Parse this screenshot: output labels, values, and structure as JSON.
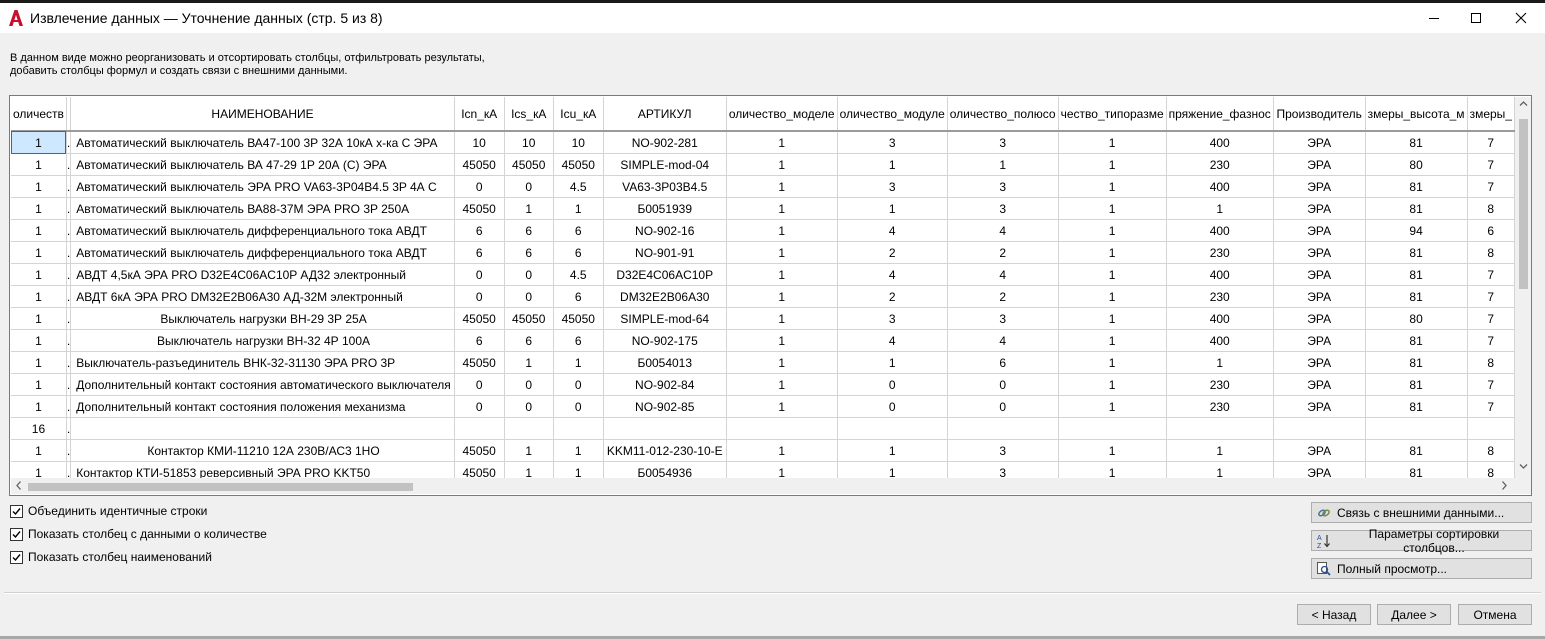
{
  "window": {
    "title": "Извлечение данных — Уточнение данных (стр. 5 из 8)"
  },
  "description": {
    "line1": "В данном виде можно реорганизовать и отсортировать столбцы, отфильтровать результаты,",
    "line2": "добавить столбцы формул и создать связи с внешними данными."
  },
  "grid": {
    "columns": [
      "оличеств",
      "",
      "НАИМЕНОВАНИЕ",
      "Icn_кA",
      "Ics_кA",
      "Icu_кA",
      "АРТИКУЛ",
      "оличество_моделе",
      "оличество_модуле",
      "оличество_полюсо",
      "чество_типоразме",
      "пряжение_фазнос",
      "Производитель",
      "змеры_высота_м",
      "змеры_"
    ],
    "rows": [
      [
        "1",
        ".",
        "Автоматический выключатель ВА47-100 3Р 32А 10кА х-ка С ЭРА",
        "10",
        "10",
        "10",
        "NO-902-281",
        "1",
        "3",
        "3",
        "1",
        "400",
        "ЭРА",
        "81",
        "7"
      ],
      [
        "1",
        ".",
        "Автоматический выключатель ВА 47-29 1Р 20А (С) ЭРА",
        "45050",
        "45050",
        "45050",
        "SIMPLE-mod-04",
        "1",
        "1",
        "1",
        "1",
        "230",
        "ЭРА",
        "80",
        "7"
      ],
      [
        "1",
        ".",
        "Автоматический выключатель ЭРА PRO VA63-3P04B4.5 3P 4А С",
        "0",
        "0",
        "4.5",
        "VA63-3P03B4.5",
        "1",
        "3",
        "3",
        "1",
        "400",
        "ЭРА",
        "81",
        "7"
      ],
      [
        "1",
        ".",
        "Автоматический выключатель ВА88-37М ЭРА PRO 3P 250А",
        "45050",
        "1",
        "1",
        "Б0051939",
        "1",
        "1",
        "3",
        "1",
        "1",
        "ЭРА",
        "81",
        "8"
      ],
      [
        "1",
        ".",
        "Автоматический выключатель дифференциального тока АВДТ",
        "6",
        "6",
        "6",
        "NO-902-16",
        "1",
        "4",
        "4",
        "1",
        "400",
        "ЭРА",
        "94",
        "6"
      ],
      [
        "1",
        ".",
        "Автоматический выключатель дифференциального тока АВДТ",
        "6",
        "6",
        "6",
        "NO-901-91",
        "1",
        "2",
        "2",
        "1",
        "230",
        "ЭРА",
        "81",
        "8"
      ],
      [
        "1",
        ".",
        "АВДТ 4,5кА ЭРА PRO D32E4C06AC10P АД32 электронный",
        "0",
        "0",
        "4.5",
        "D32E4C06AC10P",
        "1",
        "4",
        "4",
        "1",
        "400",
        "ЭРА",
        "81",
        "7"
      ],
      [
        "1",
        ".",
        "АВДТ 6кА ЭРА PRO DM32E2B06A30 АД-32М электронный",
        "0",
        "0",
        "6",
        "DM32E2B06A30",
        "1",
        "2",
        "2",
        "1",
        "230",
        "ЭРА",
        "81",
        "7"
      ],
      [
        "1",
        ".",
        "Выключатель нагрузки ВН-29 3Р 25А",
        "45050",
        "45050",
        "45050",
        "SIMPLE-mod-64",
        "1",
        "3",
        "3",
        "1",
        "400",
        "ЭРА",
        "80",
        "7"
      ],
      [
        "1",
        ".",
        "Выключатель нагрузки ВН-32 4Р 100А",
        "6",
        "6",
        "6",
        "NO-902-175",
        "1",
        "4",
        "4",
        "1",
        "400",
        "ЭРА",
        "81",
        "7"
      ],
      [
        "1",
        ".",
        "Выключатель-разъединитель ВНК-32-31130 ЭРА PRO 3P",
        "45050",
        "1",
        "1",
        "Б0054013",
        "1",
        "1",
        "6",
        "1",
        "1",
        "ЭРА",
        "81",
        "8"
      ],
      [
        "1",
        ".",
        "Дополнительный контакт состояния автоматического выключателя",
        "0",
        "0",
        "0",
        "NO-902-84",
        "1",
        "0",
        "0",
        "1",
        "230",
        "ЭРА",
        "81",
        "7"
      ],
      [
        "1",
        ".",
        "Дополнительный контакт состояния положения механизма",
        "0",
        "0",
        "0",
        "NO-902-85",
        "1",
        "0",
        "0",
        "1",
        "230",
        "ЭРА",
        "81",
        "7"
      ],
      [
        "16",
        ".",
        "",
        "",
        "",
        "",
        "",
        "",
        "",
        "",
        "",
        "",
        "",
        "",
        ""
      ],
      [
        "1",
        ".",
        "Контактор КМИ-11210 12А 230В/АС3 1НО",
        "45050",
        "1",
        "1",
        "KKM11-012-230-10-E",
        "1",
        "1",
        "3",
        "1",
        "1",
        "ЭРА",
        "81",
        "8"
      ],
      [
        "1",
        ".",
        "Контактор КТИ-51853 реверсивный ЭРА PRO KKT50",
        "45050",
        "1",
        "1",
        "Б0054936",
        "1",
        "1",
        "3",
        "1",
        "1",
        "ЭРА",
        "81",
        "8"
      ]
    ]
  },
  "options": {
    "combine_rows": "Объединить идентичные строки",
    "show_quantity": "Показать столбец с данными о количестве",
    "show_names": "Показать столбец наименований"
  },
  "side_buttons": {
    "link_external": "Связь с внешними данными...",
    "sort_params": "Параметры сортировки столбцов...",
    "full_preview": "Полный просмотр..."
  },
  "footer": {
    "back": "< Назад",
    "next": "Далее >",
    "cancel": "Отмена"
  },
  "colors": {
    "selection": "#cde8ff",
    "selection_border": "#0078d7",
    "app_icon": "#c8102e"
  }
}
